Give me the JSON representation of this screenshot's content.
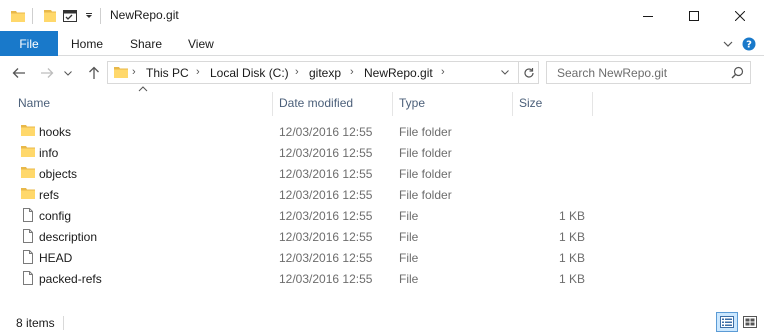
{
  "window": {
    "title": "NewRepo.git",
    "controls": [
      "minimize",
      "maximize",
      "close"
    ]
  },
  "quick_access": {
    "icons": [
      "folder-icon",
      "folder-icon",
      "properties-icon",
      "chevron-down-icon"
    ]
  },
  "ribbon": {
    "file_label": "File",
    "tabs": [
      {
        "label": "Home"
      },
      {
        "label": "Share"
      },
      {
        "label": "View"
      }
    ]
  },
  "address": {
    "crumbs": [
      "This PC",
      "Local Disk (C:)",
      "gitexp",
      "NewRepo.git"
    ]
  },
  "search": {
    "placeholder": "Search NewRepo.git"
  },
  "columns": {
    "name": "Name",
    "date": "Date modified",
    "type": "Type",
    "size": "Size"
  },
  "files": [
    {
      "name": "hooks",
      "date": "12/03/2016 12:55",
      "type": "File folder",
      "size": "",
      "icon": "folder-icon"
    },
    {
      "name": "info",
      "date": "12/03/2016 12:55",
      "type": "File folder",
      "size": "",
      "icon": "folder-icon"
    },
    {
      "name": "objects",
      "date": "12/03/2016 12:55",
      "type": "File folder",
      "size": "",
      "icon": "folder-icon"
    },
    {
      "name": "refs",
      "date": "12/03/2016 12:55",
      "type": "File folder",
      "size": "",
      "icon": "folder-icon"
    },
    {
      "name": "config",
      "date": "12/03/2016 12:55",
      "type": "File",
      "size": "1 KB",
      "icon": "file-icon"
    },
    {
      "name": "description",
      "date": "12/03/2016 12:55",
      "type": "File",
      "size": "1 KB",
      "icon": "file-icon"
    },
    {
      "name": "HEAD",
      "date": "12/03/2016 12:55",
      "type": "File",
      "size": "1 KB",
      "icon": "file-icon"
    },
    {
      "name": "packed-refs",
      "date": "12/03/2016 12:55",
      "type": "File",
      "size": "1 KB",
      "icon": "file-icon"
    }
  ],
  "status": {
    "items": "8 items"
  },
  "colors": {
    "accent": "#1979ca",
    "folder": "#ffd86b",
    "header_text": "#4c607a"
  }
}
